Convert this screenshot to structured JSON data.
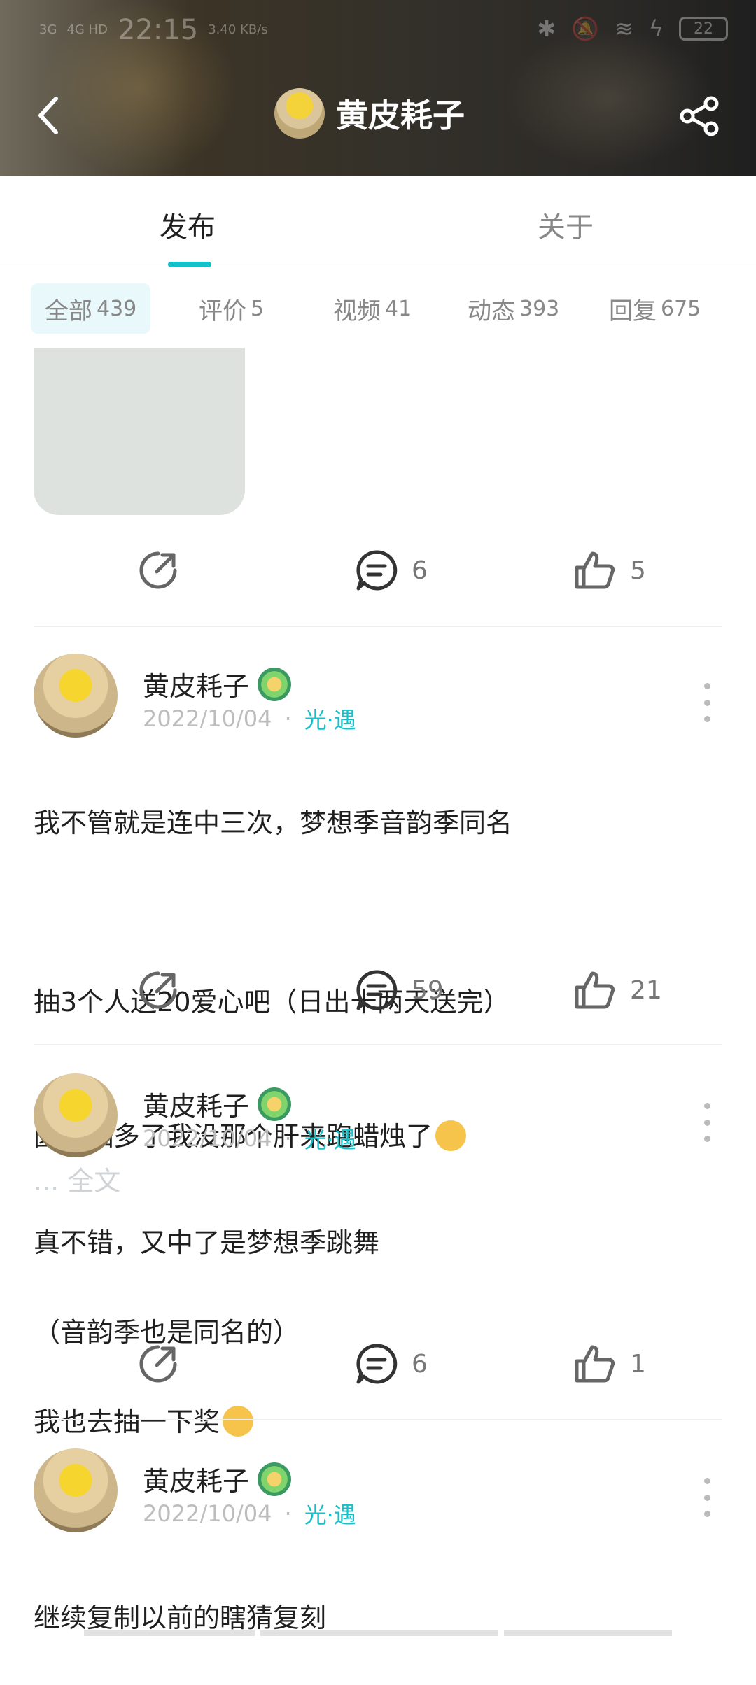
{
  "status_bar": {
    "time": "22:15",
    "network_left": "3G",
    "network_right": "4G HD",
    "speed": "3.40 KB/s",
    "battery": "22"
  },
  "header": {
    "title": "黄皮耗子",
    "icons": [
      "back-arrow-icon",
      "share-icon"
    ]
  },
  "tabs": [
    {
      "label": "发布",
      "active": true
    },
    {
      "label": "关于",
      "active": false
    }
  ],
  "filters": [
    {
      "label": "全部",
      "count": "439",
      "active": true
    },
    {
      "label": "评价",
      "count": "5",
      "active": false
    },
    {
      "label": "视频",
      "count": "41",
      "active": false
    },
    {
      "label": "动态",
      "count": "393",
      "active": false
    },
    {
      "label": "回复",
      "count": "675",
      "active": false
    }
  ],
  "first_post_actions": {
    "comments": "6",
    "likes": "5"
  },
  "posts": [
    {
      "author": "黄皮耗子",
      "date": "2022/10/04",
      "separator": "·",
      "game": "光·遇",
      "line1": "我不管就是连中三次，梦想季音韵季同名",
      "line2": "抽3个人送20爱心吧（日出十两天送完）",
      "line3": "因为抽多了我没那个肝来跑蜡烛了",
      "more_label": "... 全文",
      "comments": "59",
      "likes": "21"
    },
    {
      "author": "黄皮耗子",
      "date": "2022/10/04",
      "separator": "·",
      "game": "光·遇",
      "line1": "真不错，又中了是梦想季跳舞",
      "line2": "（音韵季也是同名的）",
      "line3": "我也去抽一下奖",
      "comments": "6",
      "likes": "1"
    },
    {
      "author": "黄皮耗子",
      "date": "2022/10/04",
      "separator": "·",
      "game": "光·遇",
      "line1": "继续复制以前的瞎猜复刻"
    }
  ],
  "colors": {
    "accent": "#14c0c9",
    "filter_active_bg": "#e8f8fb"
  }
}
